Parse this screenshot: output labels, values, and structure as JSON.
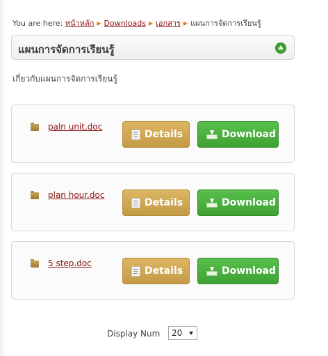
{
  "breadcrumb": {
    "prefix": "You are here:",
    "items": [
      "หน้าหลัก",
      "Downloads",
      "เอกสาร"
    ],
    "current": "แผนการจัดการเรียนรู้"
  },
  "section": {
    "title": "แผนการจัดการเรียนรู้",
    "description": "เกี่ยวกับแผนการจัดการเรียนรู้"
  },
  "files": [
    {
      "name": "paln unit.doc",
      "details_label": "Details",
      "download_label": "Download"
    },
    {
      "name": "plan hour.doc",
      "details_label": "Details",
      "download_label": "Download"
    },
    {
      "name": "5 step.doc",
      "details_label": "Details",
      "download_label": "Download"
    }
  ],
  "pagination": {
    "display_label": "Display Num",
    "display_value": "20"
  },
  "colors": {
    "details_button": "#c9a04c",
    "download_button": "#46ab3a",
    "link": "#8a1010"
  },
  "icons": {
    "collapse": "circle-up-icon",
    "file": "folder-file-icon",
    "details": "document-icon",
    "download": "download-tray-icon"
  }
}
